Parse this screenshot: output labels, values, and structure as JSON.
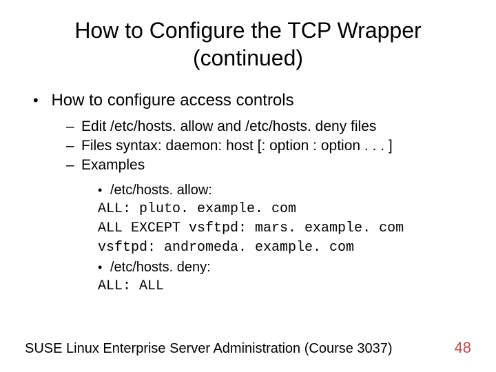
{
  "title": "How to Configure the TCP Wrapper (continued)",
  "bullet1": "How to configure access controls",
  "sub1": "Edit /etc/hosts. allow and /etc/hosts. deny files",
  "sub2": "Files syntax: daemon: host [: option : option . . . ]",
  "sub3": "Examples",
  "ex1": "/etc/hosts. allow:",
  "ex2": "ALL: pluto. example. com",
  "ex3": "ALL EXCEPT vsftpd: mars. example. com",
  "ex4": "vsftpd: andromeda. example. com",
  "ex5": "/etc/hosts. deny:",
  "ex6": "ALL: ALL",
  "footer_text": "SUSE Linux Enterprise Server Administration (Course 3037)",
  "page_number": "48"
}
